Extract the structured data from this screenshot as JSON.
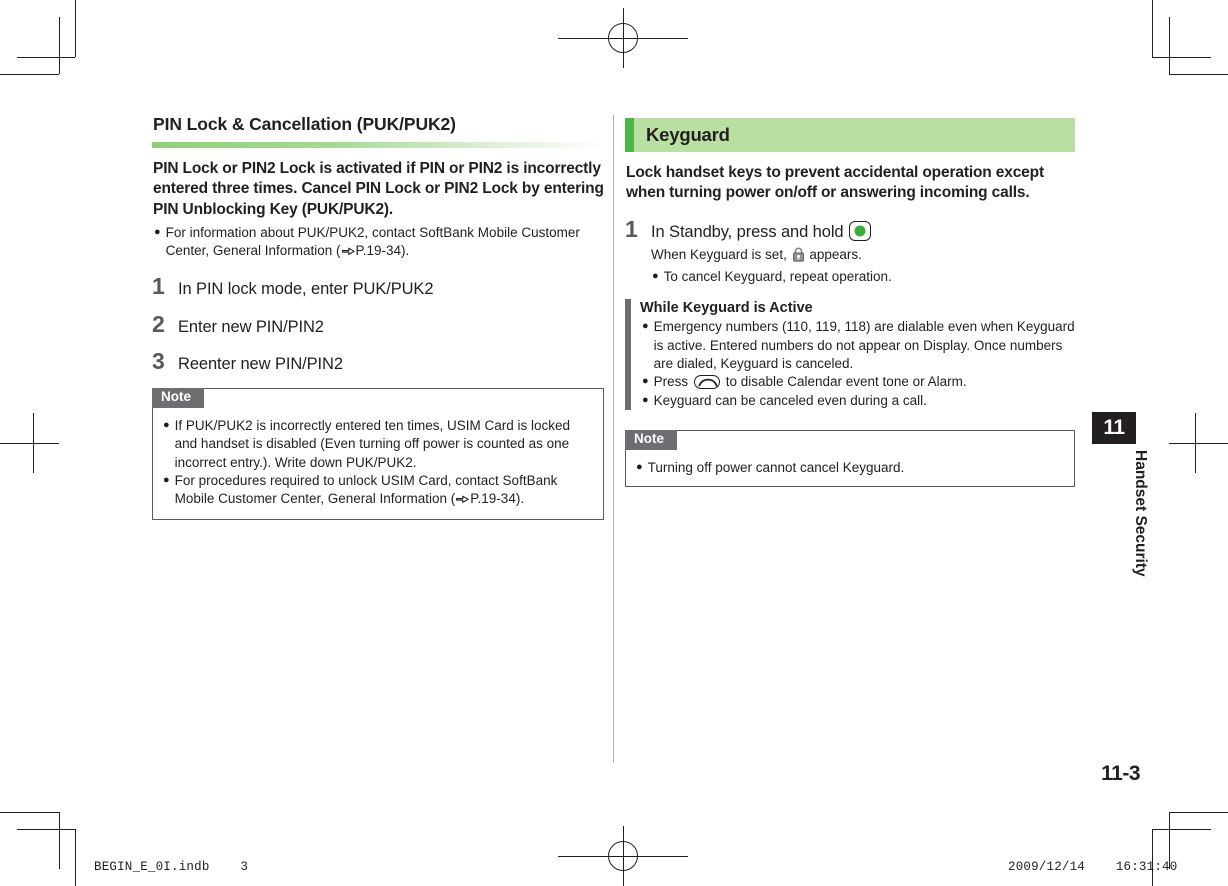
{
  "document": {
    "page_number": "11-3",
    "chapter_number": "11",
    "chapter_title": "Handset Security"
  },
  "left_column": {
    "section_title": "PIN Lock & Cancellation (PUK/PUK2)",
    "lead_paragraph": "PIN Lock or PIN2 Lock is activated if PIN or PIN2 is incorrectly entered three times. Cancel PIN Lock or PIN2 Lock by entering PIN Unblocking Key (PUK/PUK2).",
    "lead_bullet": {
      "text_before_ref": "For information about PUK/PUK2, contact SoftBank Mobile Customer Center, General Information (",
      "reference": "P.19-34",
      "text_after_ref": ")."
    },
    "steps": [
      {
        "number": "1",
        "title": "In PIN lock mode, enter PUK/PUK2"
      },
      {
        "number": "2",
        "title": "Enter new PIN/PIN2"
      },
      {
        "number": "3",
        "title": "Reenter new PIN/PIN2"
      }
    ],
    "note": {
      "label": "Note",
      "bullets": [
        "If PUK/PUK2 is incorrectly entered ten times, USIM Card is locked and handset is disabled (Even turning off power is counted as one incorrect entry.). Write down PUK/PUK2.",
        "For procedures required to unlock USIM Card, contact SoftBank Mobile Customer Center, General Information ("
      ],
      "bullet2_reference": "P.19-34",
      "bullet2_after": ")."
    }
  },
  "right_column": {
    "section_title": "Keyguard",
    "lead_paragraph": "Lock handset keys to prevent accidental operation except when turning power on/off or answering incoming calls.",
    "step": {
      "number": "1",
      "title_before_key": "In Standby, press and hold",
      "key_icon": "center-key-icon",
      "sub_before_lock": "When Keyguard is set,",
      "lock_icon": "padlock-icon",
      "sub_after_lock": "appears.",
      "bullet": "To cancel Keyguard, repeat operation."
    },
    "subsection": {
      "title": "While Keyguard is Active",
      "bullets": [
        "Emergency numbers (110, 119, 118) are dialable even when Keyguard is active. Entered numbers do not appear on Display. Once numbers are dialed, Keyguard is canceled.",
        "Keyguard can be canceled even during a call."
      ],
      "press_bullet_before": "Press",
      "press_key_icon": "end-call-key-icon",
      "press_bullet_after": "to disable Calendar event tone or Alarm."
    },
    "note": {
      "label": "Note",
      "bullets": [
        "Turning off power cannot cancel Keyguard."
      ]
    }
  },
  "footer": {
    "file_name": "BEGIN_E_0I.indb    3",
    "timestamp": "2009/12/14    16:31:40"
  },
  "colors": {
    "heading_rule_green": "#8ed07a",
    "keyguard_band": "#b9e0a2",
    "keyguard_accent": "#4cb648",
    "note_tab_gray": "#6d6e71",
    "key_dot_green": "#3aae3a"
  }
}
